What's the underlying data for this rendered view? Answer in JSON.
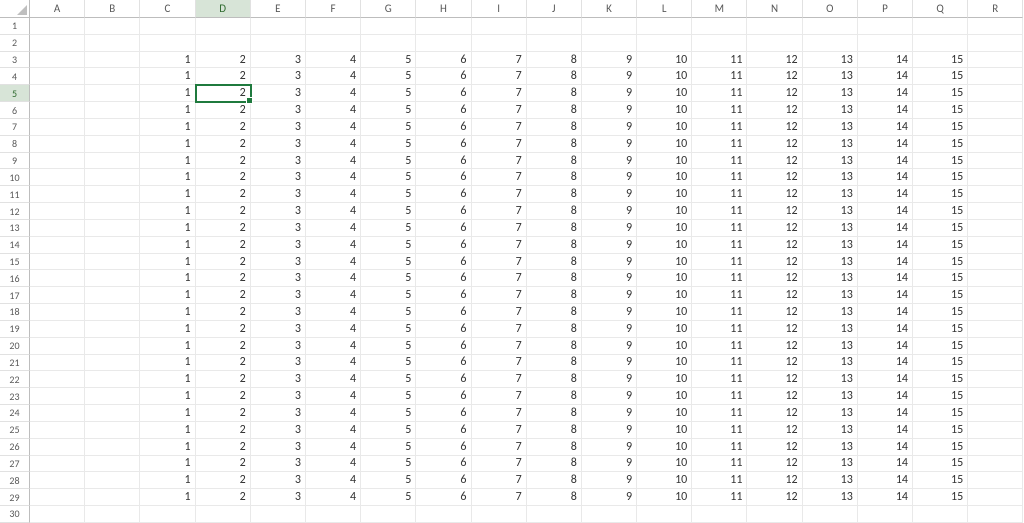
{
  "chart_data": {
    "type": "table",
    "columns": [
      "A",
      "B",
      "C",
      "D",
      "E",
      "F",
      "G",
      "H",
      "I",
      "J",
      "K",
      "L",
      "M",
      "N",
      "O",
      "P",
      "Q",
      "R"
    ],
    "row_headers": [
      1,
      2,
      3,
      4,
      5,
      6,
      7,
      8,
      9,
      10,
      11,
      12,
      13,
      14,
      15,
      16,
      17,
      18,
      19,
      20,
      21,
      22,
      23,
      24,
      25,
      26,
      27,
      28,
      29,
      30
    ],
    "cells": {
      "3": {
        "C": 1,
        "D": 2,
        "E": 3,
        "F": 4,
        "G": 5,
        "H": 6,
        "I": 7,
        "J": 8,
        "K": 9,
        "L": 10,
        "M": 11,
        "N": 12,
        "O": 13,
        "P": 14,
        "Q": 15
      },
      "4": {
        "C": 1,
        "D": 2,
        "E": 3,
        "F": 4,
        "G": 5,
        "H": 6,
        "I": 7,
        "J": 8,
        "K": 9,
        "L": 10,
        "M": 11,
        "N": 12,
        "O": 13,
        "P": 14,
        "Q": 15
      },
      "5": {
        "C": 1,
        "D": 2,
        "E": 3,
        "F": 4,
        "G": 5,
        "H": 6,
        "I": 7,
        "J": 8,
        "K": 9,
        "L": 10,
        "M": 11,
        "N": 12,
        "O": 13,
        "P": 14,
        "Q": 15
      },
      "6": {
        "C": 1,
        "D": 2,
        "E": 3,
        "F": 4,
        "G": 5,
        "H": 6,
        "I": 7,
        "J": 8,
        "K": 9,
        "L": 10,
        "M": 11,
        "N": 12,
        "O": 13,
        "P": 14,
        "Q": 15
      },
      "7": {
        "C": 1,
        "D": 2,
        "E": 3,
        "F": 4,
        "G": 5,
        "H": 6,
        "I": 7,
        "J": 8,
        "K": 9,
        "L": 10,
        "M": 11,
        "N": 12,
        "O": 13,
        "P": 14,
        "Q": 15
      },
      "8": {
        "C": 1,
        "D": 2,
        "E": 3,
        "F": 4,
        "G": 5,
        "H": 6,
        "I": 7,
        "J": 8,
        "K": 9,
        "L": 10,
        "M": 11,
        "N": 12,
        "O": 13,
        "P": 14,
        "Q": 15
      },
      "9": {
        "C": 1,
        "D": 2,
        "E": 3,
        "F": 4,
        "G": 5,
        "H": 6,
        "I": 7,
        "J": 8,
        "K": 9,
        "L": 10,
        "M": 11,
        "N": 12,
        "O": 13,
        "P": 14,
        "Q": 15
      },
      "10": {
        "C": 1,
        "D": 2,
        "E": 3,
        "F": 4,
        "G": 5,
        "H": 6,
        "I": 7,
        "J": 8,
        "K": 9,
        "L": 10,
        "M": 11,
        "N": 12,
        "O": 13,
        "P": 14,
        "Q": 15
      },
      "11": {
        "C": 1,
        "D": 2,
        "E": 3,
        "F": 4,
        "G": 5,
        "H": 6,
        "I": 7,
        "J": 8,
        "K": 9,
        "L": 10,
        "M": 11,
        "N": 12,
        "O": 13,
        "P": 14,
        "Q": 15
      },
      "12": {
        "C": 1,
        "D": 2,
        "E": 3,
        "F": 4,
        "G": 5,
        "H": 6,
        "I": 7,
        "J": 8,
        "K": 9,
        "L": 10,
        "M": 11,
        "N": 12,
        "O": 13,
        "P": 14,
        "Q": 15
      },
      "13": {
        "C": 1,
        "D": 2,
        "E": 3,
        "F": 4,
        "G": 5,
        "H": 6,
        "I": 7,
        "J": 8,
        "K": 9,
        "L": 10,
        "M": 11,
        "N": 12,
        "O": 13,
        "P": 14,
        "Q": 15
      },
      "14": {
        "C": 1,
        "D": 2,
        "E": 3,
        "F": 4,
        "G": 5,
        "H": 6,
        "I": 7,
        "J": 8,
        "K": 9,
        "L": 10,
        "M": 11,
        "N": 12,
        "O": 13,
        "P": 14,
        "Q": 15
      },
      "15": {
        "C": 1,
        "D": 2,
        "E": 3,
        "F": 4,
        "G": 5,
        "H": 6,
        "I": 7,
        "J": 8,
        "K": 9,
        "L": 10,
        "M": 11,
        "N": 12,
        "O": 13,
        "P": 14,
        "Q": 15
      },
      "16": {
        "C": 1,
        "D": 2,
        "E": 3,
        "F": 4,
        "G": 5,
        "H": 6,
        "I": 7,
        "J": 8,
        "K": 9,
        "L": 10,
        "M": 11,
        "N": 12,
        "O": 13,
        "P": 14,
        "Q": 15
      },
      "17": {
        "C": 1,
        "D": 2,
        "E": 3,
        "F": 4,
        "G": 5,
        "H": 6,
        "I": 7,
        "J": 8,
        "K": 9,
        "L": 10,
        "M": 11,
        "N": 12,
        "O": 13,
        "P": 14,
        "Q": 15
      },
      "18": {
        "C": 1,
        "D": 2,
        "E": 3,
        "F": 4,
        "G": 5,
        "H": 6,
        "I": 7,
        "J": 8,
        "K": 9,
        "L": 10,
        "M": 11,
        "N": 12,
        "O": 13,
        "P": 14,
        "Q": 15
      },
      "19": {
        "C": 1,
        "D": 2,
        "E": 3,
        "F": 4,
        "G": 5,
        "H": 6,
        "I": 7,
        "J": 8,
        "K": 9,
        "L": 10,
        "M": 11,
        "N": 12,
        "O": 13,
        "P": 14,
        "Q": 15
      },
      "20": {
        "C": 1,
        "D": 2,
        "E": 3,
        "F": 4,
        "G": 5,
        "H": 6,
        "I": 7,
        "J": 8,
        "K": 9,
        "L": 10,
        "M": 11,
        "N": 12,
        "O": 13,
        "P": 14,
        "Q": 15
      },
      "21": {
        "C": 1,
        "D": 2,
        "E": 3,
        "F": 4,
        "G": 5,
        "H": 6,
        "I": 7,
        "J": 8,
        "K": 9,
        "L": 10,
        "M": 11,
        "N": 12,
        "O": 13,
        "P": 14,
        "Q": 15
      },
      "22": {
        "C": 1,
        "D": 2,
        "E": 3,
        "F": 4,
        "G": 5,
        "H": 6,
        "I": 7,
        "J": 8,
        "K": 9,
        "L": 10,
        "M": 11,
        "N": 12,
        "O": 13,
        "P": 14,
        "Q": 15
      },
      "23": {
        "C": 1,
        "D": 2,
        "E": 3,
        "F": 4,
        "G": 5,
        "H": 6,
        "I": 7,
        "J": 8,
        "K": 9,
        "L": 10,
        "M": 11,
        "N": 12,
        "O": 13,
        "P": 14,
        "Q": 15
      },
      "24": {
        "C": 1,
        "D": 2,
        "E": 3,
        "F": 4,
        "G": 5,
        "H": 6,
        "I": 7,
        "J": 8,
        "K": 9,
        "L": 10,
        "M": 11,
        "N": 12,
        "O": 13,
        "P": 14,
        "Q": 15
      },
      "25": {
        "C": 1,
        "D": 2,
        "E": 3,
        "F": 4,
        "G": 5,
        "H": 6,
        "I": 7,
        "J": 8,
        "K": 9,
        "L": 10,
        "M": 11,
        "N": 12,
        "O": 13,
        "P": 14,
        "Q": 15
      },
      "26": {
        "C": 1,
        "D": 2,
        "E": 3,
        "F": 4,
        "G": 5,
        "H": 6,
        "I": 7,
        "J": 8,
        "K": 9,
        "L": 10,
        "M": 11,
        "N": 12,
        "O": 13,
        "P": 14,
        "Q": 15
      },
      "27": {
        "C": 1,
        "D": 2,
        "E": 3,
        "F": 4,
        "G": 5,
        "H": 6,
        "I": 7,
        "J": 8,
        "K": 9,
        "L": 10,
        "M": 11,
        "N": 12,
        "O": 13,
        "P": 14,
        "Q": 15
      },
      "28": {
        "C": 1,
        "D": 2,
        "E": 3,
        "F": 4,
        "G": 5,
        "H": 6,
        "I": 7,
        "J": 8,
        "K": 9,
        "L": 10,
        "M": 11,
        "N": 12,
        "O": 13,
        "P": 14,
        "Q": 15
      },
      "29": {
        "C": 1,
        "D": 2,
        "E": 3,
        "F": 4,
        "G": 5,
        "H": 6,
        "I": 7,
        "J": 8,
        "K": 9,
        "L": 10,
        "M": 11,
        "N": 12,
        "O": 13,
        "P": 14,
        "Q": 15
      }
    },
    "selected": {
      "row": 5,
      "col": "D"
    }
  }
}
